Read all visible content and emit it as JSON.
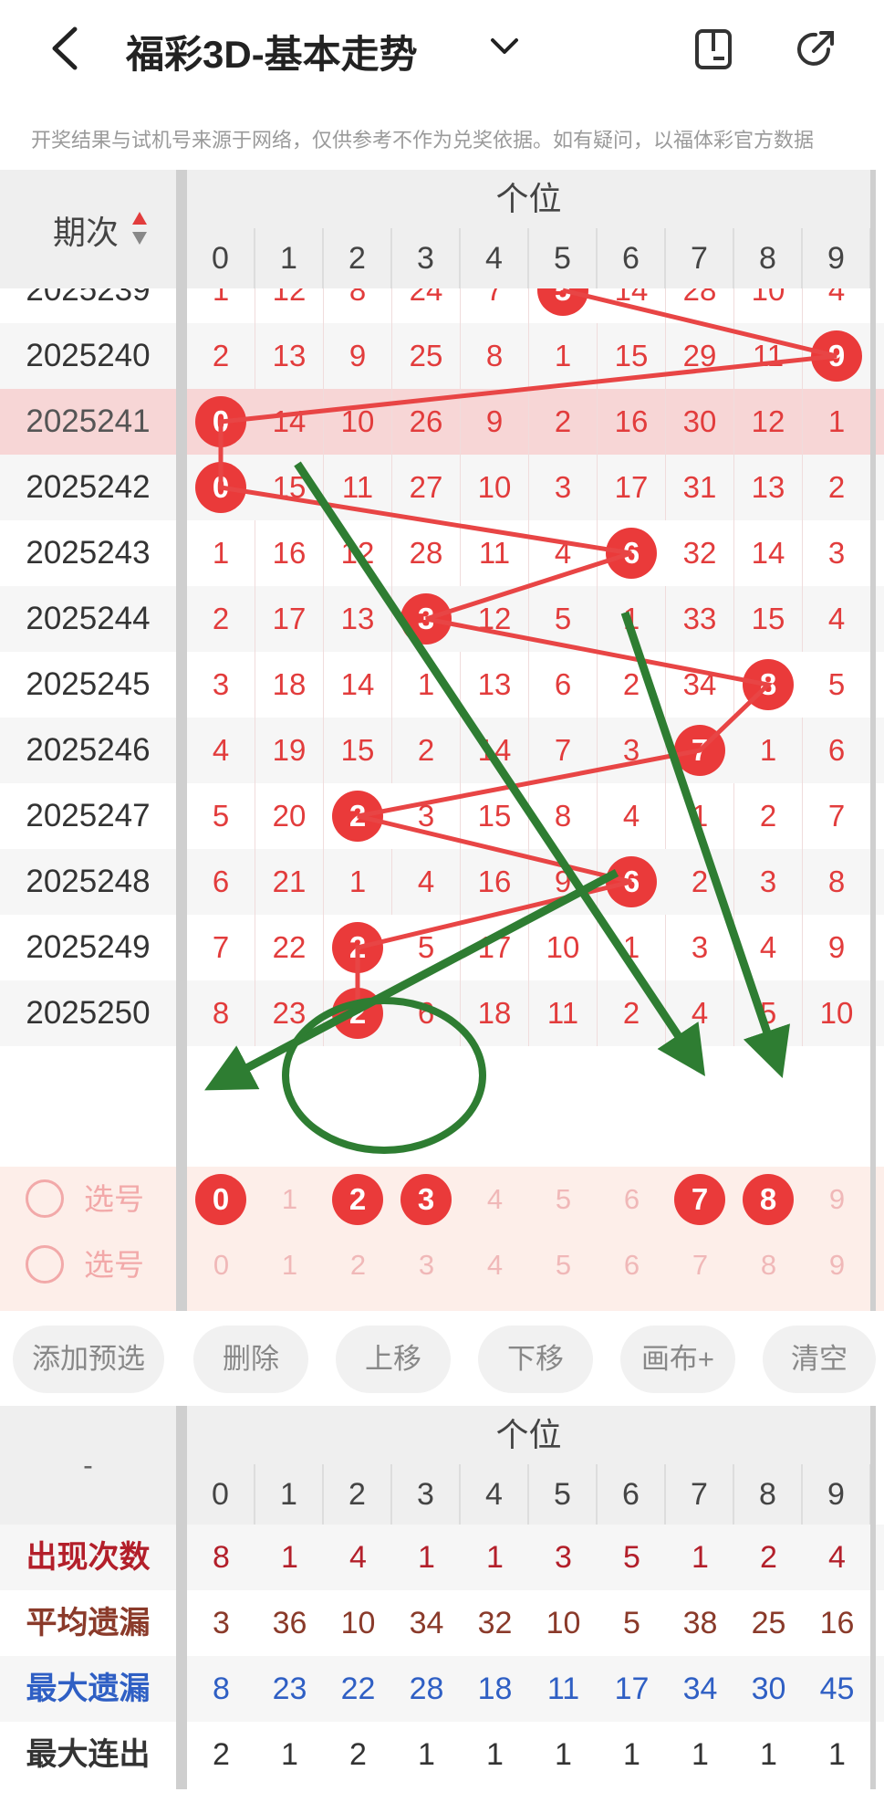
{
  "header": {
    "title": "福彩3D-基本走势",
    "notice": "开奖结果与试机号来源于网络，仅供参考不作为兑奖依据。如有疑问，以福体彩官方数据"
  },
  "table": {
    "period_header": "期次",
    "group_label": "个位",
    "digits": [
      "0",
      "1",
      "2",
      "3",
      "4",
      "5",
      "6",
      "7",
      "8",
      "9"
    ],
    "rows": [
      {
        "period": "2025239",
        "values": [
          "1",
          "12",
          "8",
          "24",
          "7",
          "5",
          "14",
          "28",
          "10",
          "4"
        ],
        "hit": 5
      },
      {
        "period": "2025240",
        "values": [
          "2",
          "13",
          "9",
          "25",
          "8",
          "1",
          "15",
          "29",
          "11",
          "9"
        ],
        "hit": 9
      },
      {
        "period": "2025241",
        "values": [
          "0",
          "14",
          "10",
          "26",
          "9",
          "2",
          "16",
          "30",
          "12",
          "1"
        ],
        "hit": 0
      },
      {
        "period": "2025242",
        "values": [
          "0",
          "15",
          "11",
          "27",
          "10",
          "3",
          "17",
          "31",
          "13",
          "2"
        ],
        "hit": 0
      },
      {
        "period": "2025243",
        "values": [
          "1",
          "16",
          "12",
          "28",
          "11",
          "4",
          "6",
          "32",
          "14",
          "3"
        ],
        "hit": 6
      },
      {
        "period": "2025244",
        "values": [
          "2",
          "17",
          "13",
          "3",
          "12",
          "5",
          "1",
          "33",
          "15",
          "4"
        ],
        "hit": 3
      },
      {
        "period": "2025245",
        "values": [
          "3",
          "18",
          "14",
          "1",
          "13",
          "6",
          "2",
          "34",
          "8",
          "5"
        ],
        "hit": 8
      },
      {
        "period": "2025246",
        "values": [
          "4",
          "19",
          "15",
          "2",
          "14",
          "7",
          "3",
          "7",
          "1",
          "6"
        ],
        "hit": 7
      },
      {
        "period": "2025247",
        "values": [
          "5",
          "20",
          "2",
          "3",
          "15",
          "8",
          "4",
          "1",
          "2",
          "7"
        ],
        "hit": 2
      },
      {
        "period": "2025248",
        "values": [
          "6",
          "21",
          "1",
          "4",
          "16",
          "9",
          "6",
          "2",
          "3",
          "8"
        ],
        "hit": 6
      },
      {
        "period": "2025249",
        "values": [
          "7",
          "22",
          "2",
          "5",
          "17",
          "10",
          "1",
          "3",
          "4",
          "9"
        ],
        "hit": 2
      },
      {
        "period": "2025250",
        "values": [
          "8",
          "23",
          "2",
          "6",
          "18",
          "11",
          "2",
          "4",
          "5",
          "10"
        ],
        "hit": 2
      }
    ],
    "select_label": "选号",
    "selections": [
      {
        "picked": [
          "0",
          "2",
          "3",
          "7",
          "8"
        ]
      },
      {
        "picked": []
      },
      {
        "picked": []
      },
      {
        "picked": []
      }
    ]
  },
  "toolbar": [
    "添加预选",
    "删除",
    "上移",
    "下移",
    "画布+",
    "清空"
  ],
  "stats": {
    "left_header": "-",
    "group_label": "个位",
    "digits": [
      "0",
      "1",
      "2",
      "3",
      "4",
      "5",
      "6",
      "7",
      "8",
      "9"
    ],
    "rows": [
      {
        "label": "出现次数",
        "values": [
          "8",
          "1",
          "4",
          "1",
          "1",
          "3",
          "5",
          "1",
          "2",
          "4"
        ],
        "color": "#b31f2a"
      },
      {
        "label": "平均遗漏",
        "values": [
          "3",
          "36",
          "10",
          "34",
          "32",
          "10",
          "5",
          "38",
          "25",
          "16"
        ],
        "color": "#8a3a2a"
      },
      {
        "label": "最大遗漏",
        "values": [
          "8",
          "23",
          "22",
          "28",
          "18",
          "11",
          "17",
          "34",
          "30",
          "45"
        ],
        "color": "#2f5fc4"
      },
      {
        "label": "最大连出",
        "values": [
          "2",
          "1",
          "2",
          "1",
          "1",
          "1",
          "1",
          "1",
          "1",
          "1"
        ],
        "color": "#333333"
      }
    ]
  },
  "colors": {
    "ball": "#ea3a3a",
    "highlight_row": "#f7d6d6",
    "select_bg": "#fdeee9",
    "annotation": "#2e7d32"
  },
  "icons": [
    "back-arrow-icon",
    "chevron-down-icon",
    "phone-icon",
    "share-icon",
    "sort-icon"
  ]
}
